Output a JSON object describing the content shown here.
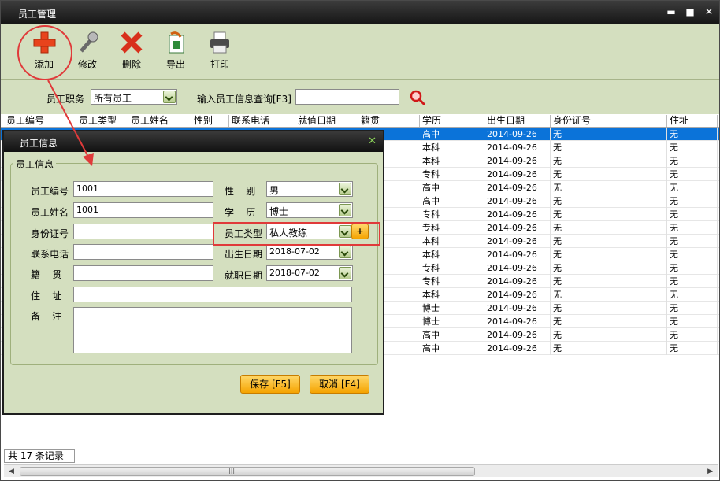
{
  "window": {
    "title": "员工管理"
  },
  "toolbar": {
    "add": "添加",
    "edit": "修改",
    "delete": "删除",
    "export": "导出",
    "print": "打印"
  },
  "filter": {
    "position_label": "员工职务",
    "position_value": "所有员工",
    "search_label": "输入员工信息查询[F3]",
    "search_value": ""
  },
  "grid": {
    "columns": [
      "员工编号",
      "员工类型",
      "员工姓名",
      "性别",
      "联系电话",
      "就值日期",
      "籍贯",
      "学历",
      "出生日期",
      "身份证号",
      "住址"
    ],
    "rows": [
      {
        "edu": "高中",
        "birth": "2014-09-26",
        "id": "无",
        "addr": "无"
      },
      {
        "edu": "本科",
        "birth": "2014-09-26",
        "id": "无",
        "addr": "无"
      },
      {
        "edu": "本科",
        "birth": "2014-09-26",
        "id": "无",
        "addr": "无"
      },
      {
        "edu": "专科",
        "birth": "2014-09-26",
        "id": "无",
        "addr": "无"
      },
      {
        "edu": "高中",
        "birth": "2014-09-26",
        "id": "无",
        "addr": "无"
      },
      {
        "edu": "高中",
        "birth": "2014-09-26",
        "id": "无",
        "addr": "无"
      },
      {
        "edu": "专科",
        "birth": "2014-09-26",
        "id": "无",
        "addr": "无"
      },
      {
        "edu": "专科",
        "birth": "2014-09-26",
        "id": "无",
        "addr": "无"
      },
      {
        "edu": "本科",
        "birth": "2014-09-26",
        "id": "无",
        "addr": "无"
      },
      {
        "edu": "本科",
        "birth": "2014-09-26",
        "id": "无",
        "addr": "无"
      },
      {
        "edu": "专科",
        "birth": "2014-09-26",
        "id": "无",
        "addr": "无"
      },
      {
        "edu": "专科",
        "birth": "2014-09-26",
        "id": "无",
        "addr": "无"
      },
      {
        "edu": "本科",
        "birth": "2014-09-26",
        "id": "无",
        "addr": "无"
      },
      {
        "edu": "博士",
        "birth": "2014-09-26",
        "id": "无",
        "addr": "无"
      },
      {
        "edu": "博士",
        "birth": "2014-09-26",
        "id": "无",
        "addr": "无"
      },
      {
        "edu": "高中",
        "birth": "2014-09-26",
        "id": "无",
        "addr": "无"
      },
      {
        "edu": "高中",
        "birth": "2014-09-26",
        "id": "无",
        "addr": "无"
      }
    ]
  },
  "status": {
    "records": "共 17 条记录"
  },
  "dialog": {
    "title": "员工信息",
    "group": "员工信息",
    "emp_no_label": "员工编号",
    "emp_no_value": "1001",
    "emp_name_label": "员工姓名",
    "emp_name_value": "1001",
    "idcard_label": "身份证号",
    "phone_label": "联系电话",
    "native_label": "籍    贯",
    "address_label": "住    址",
    "remark_label": "备    注",
    "gender_label": "性    别",
    "gender_value": "男",
    "edu_label": "学    历",
    "edu_value": "博士",
    "type_label": "员工类型",
    "type_value": "私人教练",
    "type_add": "+",
    "birth_label": "出生日期",
    "birth_value": "2018-07-02",
    "hire_label": "就职日期",
    "hire_value": "2018-07-02",
    "save": "保存 [F5]",
    "cancel": "取消 [F4]"
  },
  "colors": {
    "selected_row": "#0b73d9",
    "panel": "#d4dfbf",
    "annotation": "#e03a3a"
  },
  "icons": [
    "plus-icon",
    "wrench-icon",
    "delete-x-icon",
    "excel-export-icon",
    "printer-icon",
    "search-magnifier-icon"
  ]
}
